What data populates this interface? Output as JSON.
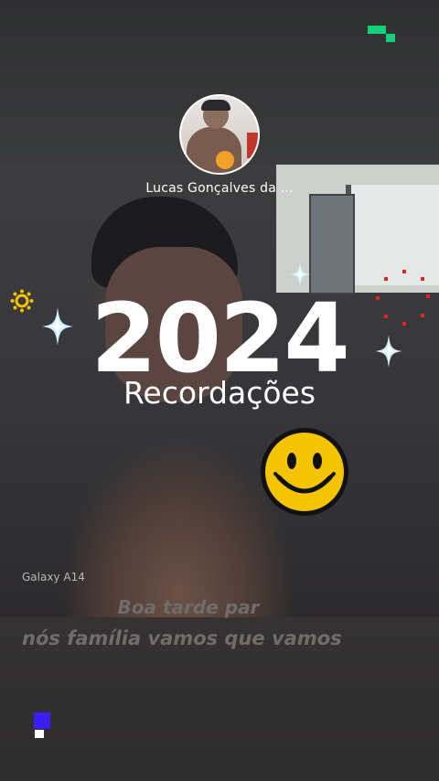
{
  "profile": {
    "name": "Lucas Gonçalves da ..."
  },
  "memory": {
    "year": "2024",
    "title": "Recordações"
  },
  "photo": {
    "watermark": "Galaxy A14"
  },
  "caption": {
    "line1": "Boa tarde par",
    "line2": "nós família vamos que vamos"
  },
  "colors": {
    "accent_green": "#12d07a",
    "accent_blue": "#3b1ff2",
    "smiley_yellow": "#f5c400"
  },
  "icons": [
    "sparkle-icon",
    "smiley-face-icon",
    "sun-icon",
    "red-dots-burst-icon"
  ]
}
